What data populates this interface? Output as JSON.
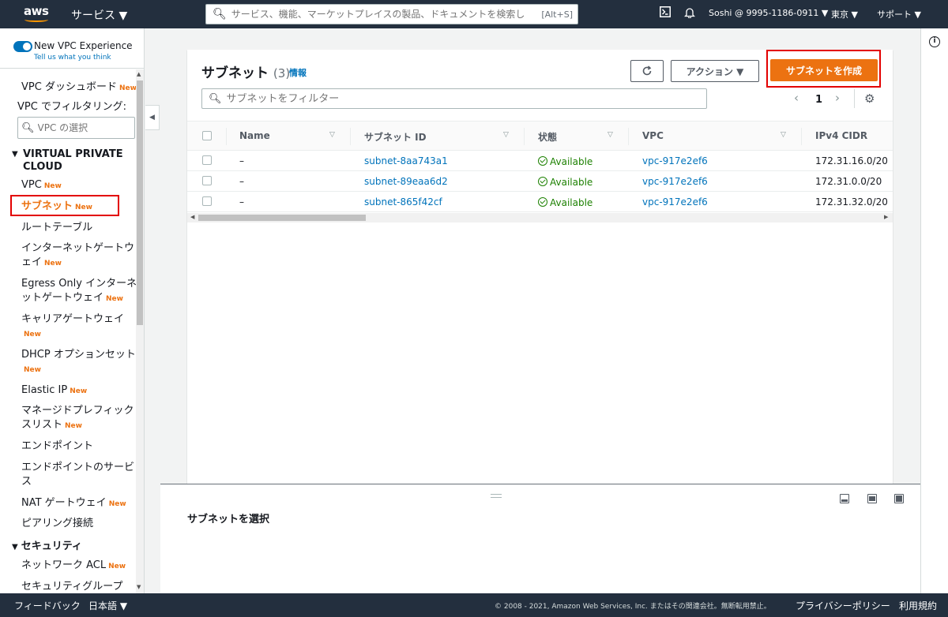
{
  "topnav": {
    "logo": "aws",
    "services": "サービス ▼",
    "search_placeholder": "サービス、機能、マーケットプレイスの製品、ドキュメントを検索し",
    "search_shortcut": "[Alt+S]",
    "cloudshell_icon": "terminal-icon",
    "bell_icon": "bell-icon",
    "account": "Soshi @ 9995-1186-0911 ▼",
    "region": "東京 ▼",
    "support": "サポート ▼"
  },
  "sidebar": {
    "toggle_label": "New VPC Experience",
    "toggle_link": "Tell us what you think",
    "dashboard": "VPC ダッシュボード",
    "new_badge": "New",
    "filter_label": "VPC でフィルタリング:",
    "vpc_select_placeholder": "VPC の選択",
    "section_vpc": "VIRTUAL PRIVATE CLOUD",
    "items": {
      "vpc": "VPC",
      "subnets": "サブネット",
      "route_tables": "ルートテーブル",
      "igw_1": "インターネットゲートウ",
      "igw_2": "ェイ",
      "egress_1": "Egress Only インターネ",
      "egress_2": "ットゲートウェイ",
      "carrier": "キャリアゲートウェイ",
      "dhcp": "DHCP オプションセット",
      "eip": "Elastic IP",
      "prefix_1": "マネージドプレフィック",
      "prefix_2": "スリスト",
      "endpoints": "エンドポイント",
      "endpoint_svc_1": "エンドポイントのサービ",
      "endpoint_svc_2": "ス",
      "nat": "NAT ゲートウェイ",
      "peering": "ピアリング接続"
    },
    "section_security": "セキュリティ",
    "security_items": {
      "nacl": "ネットワーク ACL",
      "sg": "セキュリティグループ"
    }
  },
  "main": {
    "title": "サブネット",
    "count": "(3)",
    "info": "情報",
    "refresh_icon": "refresh-icon",
    "actions_button": "アクション ▼",
    "create_button": "サブネットを作成",
    "filter_placeholder": "サブネットをフィルター",
    "page_number": "1",
    "columns": [
      "Name",
      "サブネット ID",
      "状態",
      "VPC",
      "IPv4 CIDR"
    ],
    "rows": [
      {
        "name": "–",
        "subnet_id": "subnet-8aa743a1",
        "state": "Available",
        "vpc": "vpc-917e2ef6",
        "cidr": "172.31.16.0/20"
      },
      {
        "name": "–",
        "subnet_id": "subnet-89eaa6d2",
        "state": "Available",
        "vpc": "vpc-917e2ef6",
        "cidr": "172.31.0.0/20"
      },
      {
        "name": "–",
        "subnet_id": "subnet-865f42cf",
        "state": "Available",
        "vpc": "vpc-917e2ef6",
        "cidr": "172.31.32.0/20"
      }
    ]
  },
  "split_panel": {
    "title": "サブネットを選択"
  },
  "footer": {
    "feedback": "フィードバック",
    "language": "日本語 ▼",
    "copyright": "© 2008 - 2021, Amazon Web Services, Inc. またはその関連会社。無断転用禁止。",
    "privacy": "プライバシーポリシー",
    "terms": "利用規約"
  },
  "colors": {
    "nav_bg": "#232f3e",
    "primary_button": "#ec7211",
    "link": "#0073bb",
    "success": "#1d8102",
    "highlight_box": "#e30000"
  }
}
